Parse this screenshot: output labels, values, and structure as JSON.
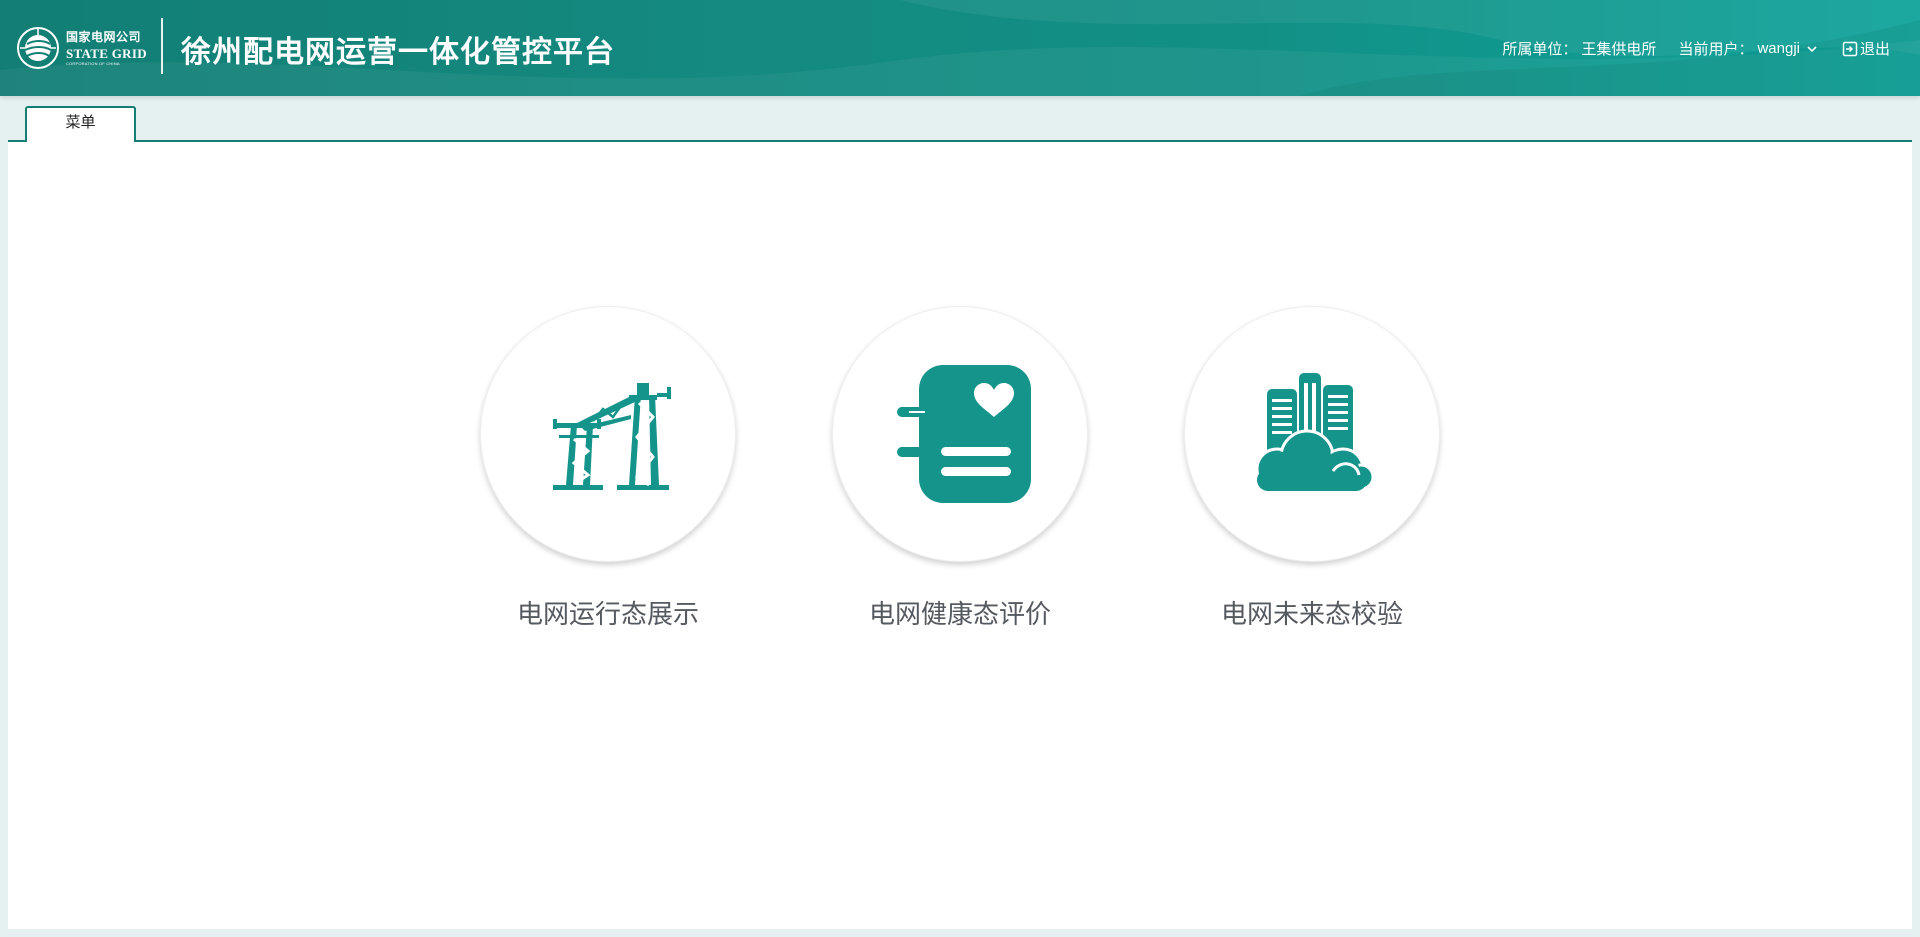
{
  "header": {
    "logo": {
      "cn": "国家电网公司",
      "en": "STATE GRID",
      "sub": "CORPORATION OF CHINA"
    },
    "title": "徐州配电网运营一体化管控平台",
    "unit_label": "所属单位：",
    "unit_value": "王集供电所",
    "user_label": "当前用户：",
    "user_value": "wangji",
    "logout_label": "退出"
  },
  "tabs": [
    {
      "label": "菜单",
      "active": true
    }
  ],
  "menu": [
    {
      "label": "电网运行态展示",
      "icon": "transmission-tower-icon"
    },
    {
      "label": "电网健康态评价",
      "icon": "health-notebook-icon"
    },
    {
      "label": "电网未来态校验",
      "icon": "city-cloud-icon"
    }
  ],
  "colors": {
    "header_start": "#127e74",
    "header_end": "#0ea39a",
    "accent": "#127e74",
    "icon": "#14948a",
    "page_bg": "#e4f1f0",
    "label_text": "#555a60"
  }
}
